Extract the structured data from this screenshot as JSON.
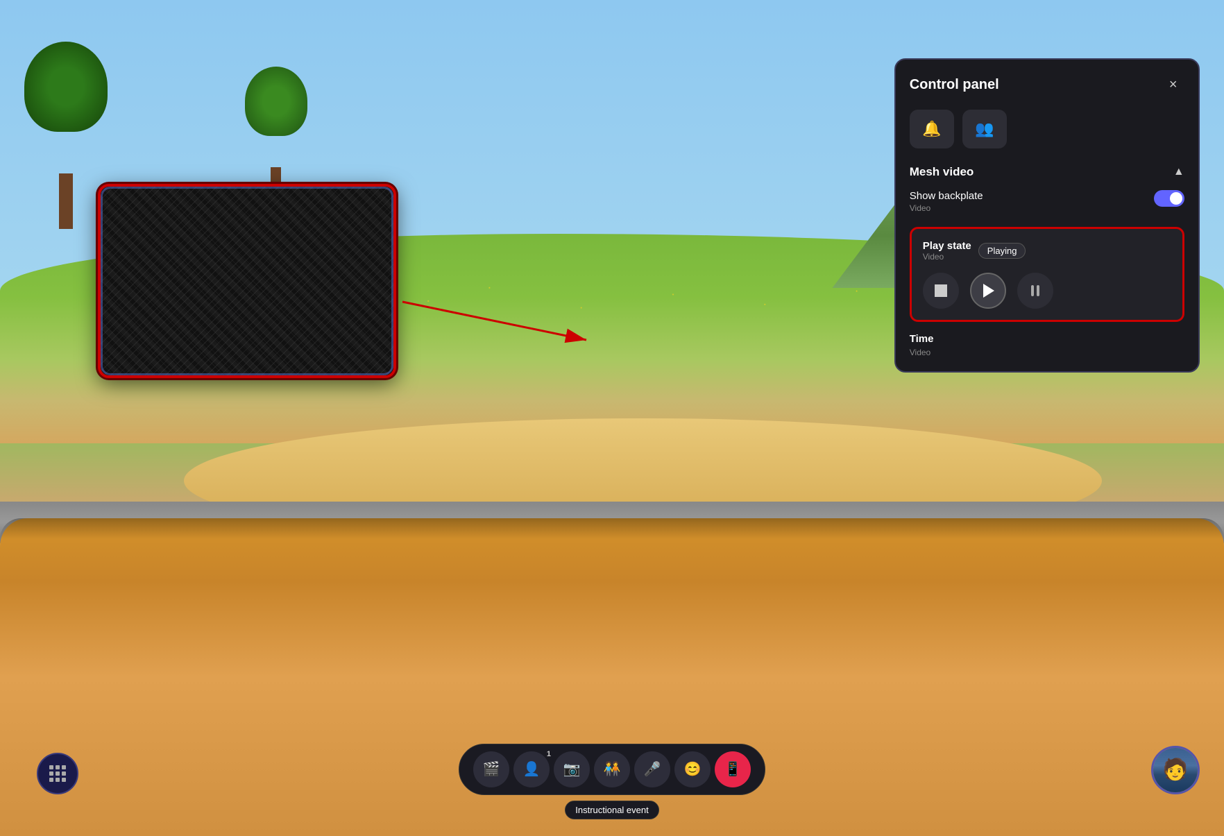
{
  "scene": {
    "background": "virtual environment with trees, hills, and table"
  },
  "control_panel": {
    "title": "Control panel",
    "close_label": "×",
    "icon_buttons": [
      {
        "id": "bell-icon",
        "symbol": "🔔"
      },
      {
        "id": "people-icon",
        "symbol": "👥"
      }
    ],
    "mesh_video_section": {
      "title": "Mesh video",
      "chevron": "▲",
      "show_backplate": {
        "label": "Show backplate",
        "sublabel": "Video",
        "toggle_on": true
      },
      "play_state": {
        "label": "Play state",
        "sublabel": "Video",
        "badge": "Playing",
        "controls": {
          "stop_label": "Stop",
          "play_label": "Play",
          "pause_label": "Pause"
        }
      },
      "time_section": {
        "label": "Time",
        "sublabel": "Video"
      }
    }
  },
  "toolbar": {
    "buttons": [
      {
        "id": "scenes-btn",
        "symbol": "🎬",
        "label": "Scenes"
      },
      {
        "id": "participants-btn",
        "symbol": "👤",
        "label": "Participants",
        "count": "1"
      },
      {
        "id": "camera-btn",
        "symbol": "📷",
        "label": "Camera"
      },
      {
        "id": "emotes-btn",
        "symbol": "🧑‍🤝‍🧑",
        "label": "Emotes"
      },
      {
        "id": "mic-btn",
        "symbol": "🎤",
        "label": "Microphone"
      },
      {
        "id": "emoji-btn",
        "symbol": "😊",
        "label": "Emoji"
      },
      {
        "id": "active-btn",
        "symbol": "📱",
        "label": "Active",
        "active": true
      }
    ],
    "event_label": "Instructional event"
  },
  "apps_button": {
    "label": "Apps"
  },
  "avatar": {
    "label": "User avatar"
  }
}
